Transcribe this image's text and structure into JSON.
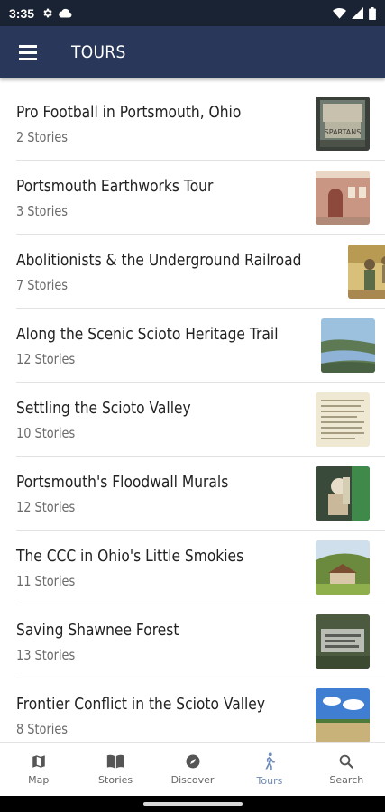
{
  "status_bar": {
    "time": "3:35"
  },
  "app_bar": {
    "title": "TOURS"
  },
  "tours": [
    {
      "title": "Pro Football in Portsmouth, Ohio",
      "stories": "2 Stories"
    },
    {
      "title": "Portsmouth Earthworks Tour",
      "stories": "3 Stories"
    },
    {
      "title": "Abolitionists & the Underground Railroad",
      "stories": "7 Stories"
    },
    {
      "title": "Along the Scenic Scioto Heritage Trail",
      "stories": "12 Stories"
    },
    {
      "title": "Settling the Scioto Valley",
      "stories": "10 Stories"
    },
    {
      "title": "Portsmouth's Floodwall Murals",
      "stories": "12 Stories"
    },
    {
      "title": "The CCC in Ohio's Little Smokies",
      "stories": "11 Stories"
    },
    {
      "title": "Saving Shawnee Forest",
      "stories": "13 Stories"
    },
    {
      "title": "Frontier Conflict in the Scioto Valley",
      "stories": "8 Stories"
    }
  ],
  "bottom_nav": [
    {
      "label": "Map",
      "icon": "map-icon"
    },
    {
      "label": "Stories",
      "icon": "book-icon"
    },
    {
      "label": "Discover",
      "icon": "compass-icon"
    },
    {
      "label": "Tours",
      "icon": "walking-icon",
      "active": true
    },
    {
      "label": "Search",
      "icon": "search-icon"
    }
  ],
  "colors": {
    "app_bar": "#28375a",
    "status_bar": "#1a2333",
    "active_nav": "#6f8ab5"
  }
}
